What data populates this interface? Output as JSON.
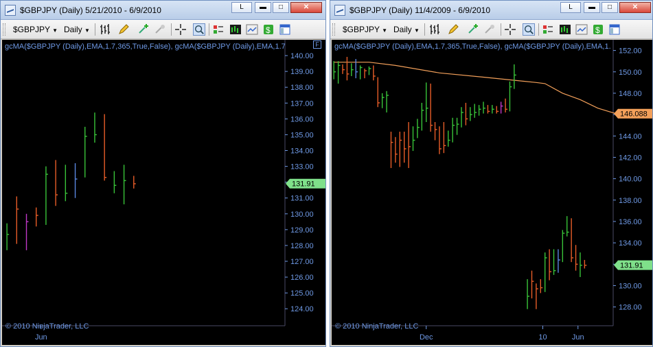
{
  "windows": [
    {
      "id": "left",
      "title": "$GBPJPY (Daily)  5/21/2010 - 6/9/2010",
      "title_buttons": [
        "L",
        "▬",
        "□",
        "✕"
      ],
      "toolbar": {
        "instrument": "$GBPJPY",
        "interval": "Daily"
      },
      "caption": "gcMA($GBPJPY (Daily),EMA,1.7,365,True,False), gcMA($GBPJPY (Daily),EMA,1.7",
      "corner_box": "F",
      "copyright": "© 2010 NinjaTrader, LLC",
      "price_badges": [
        {
          "text": "131.91",
          "value": 131.91,
          "color": "#7fe08a"
        }
      ]
    },
    {
      "id": "right",
      "title": "$GBPJPY (Daily)  11/4/2009 - 6/9/2010",
      "title_buttons": [
        "L",
        "▬",
        "□",
        "✕"
      ],
      "toolbar": {
        "instrument": "$GBPJPY",
        "interval": "Daily"
      },
      "caption": "gcMA($GBPJPY (Daily),EMA,1.7,365,True,False), gcMA($GBPJPY (Daily),EMA,1.",
      "corner_box": "",
      "copyright": "© 2010 NinjaTrader, LLC",
      "price_badges": [
        {
          "text": "146.088",
          "value": 146.088,
          "color": "#f3a05a"
        },
        {
          "text": "131.91",
          "value": 131.91,
          "color": "#7fe08a"
        }
      ]
    }
  ],
  "chart_data": [
    {
      "type": "ohlc",
      "instrument": "$GBPJPY (Daily)",
      "y_ticks": [
        140,
        139,
        138,
        137,
        136,
        135,
        134,
        133,
        132,
        131,
        130,
        129,
        128,
        127,
        126,
        125,
        124
      ],
      "y_tick_labels": [
        "140.00",
        "139.00",
        "138.00",
        "137.00",
        "136.00",
        "135.00",
        "134.00",
        "133.00",
        "132.00",
        "131.00",
        "130.00",
        "129.00",
        "128.00",
        "127.00",
        "126.00",
        "125.00",
        "124.00"
      ],
      "ylim": [
        123.1,
        141.0
      ],
      "x_labels": [
        {
          "label": "Jun",
          "bar": 3.5
        }
      ],
      "n_slots": 29,
      "bars": [
        {
          "h": 129.4,
          "l": 127.7,
          "c": 128.7,
          "color": "#39c439"
        },
        {
          "h": 131.1,
          "l": 128.1,
          "c": 130.3,
          "color": "#e85d28"
        },
        {
          "h": 130.0,
          "l": 127.7,
          "c": 129.5,
          "color": "#c038c8"
        },
        {
          "h": 130.4,
          "l": 129.2,
          "c": 129.9,
          "color": "#e85d28"
        },
        {
          "h": 133.0,
          "l": 129.3,
          "c": 132.5,
          "color": "#39c439"
        },
        {
          "h": 133.4,
          "l": 130.5,
          "c": 131.2,
          "color": "#e85d28"
        },
        {
          "h": 133.1,
          "l": 130.8,
          "c": 131.3,
          "color": "#39c439"
        },
        {
          "h": 133.2,
          "l": 131.0,
          "c": 132.2,
          "color": "#5a86e0"
        },
        {
          "h": 135.5,
          "l": 132.3,
          "c": 134.9,
          "color": "#39c439"
        },
        {
          "h": 136.4,
          "l": 134.5,
          "c": 135.0,
          "color": "#39c439"
        },
        {
          "h": 136.3,
          "l": 132.1,
          "c": 132.3,
          "color": "#e85d28"
        },
        {
          "h": 132.7,
          "l": 131.3,
          "c": 131.8,
          "color": "#39c439"
        },
        {
          "h": 133.1,
          "l": 130.6,
          "c": 132.1,
          "color": "#39c439"
        },
        {
          "h": 132.4,
          "l": 131.6,
          "c": 131.9,
          "color": "#e85d28"
        }
      ]
    },
    {
      "type": "ohlc",
      "instrument": "$GBPJPY (Daily)",
      "y_ticks": [
        152,
        150,
        148,
        146,
        144,
        142,
        140,
        138,
        136,
        134,
        132,
        130,
        128
      ],
      "y_tick_labels": [
        "152.00",
        "150.00",
        "148.00",
        "146.00",
        "144.00",
        "142.00",
        "140.00",
        "138.00",
        "136.00",
        "134.00",
        "132.00",
        "130.00",
        "128.00"
      ],
      "ylim": [
        126.5,
        153.0
      ],
      "x_labels": [
        {
          "label": "Dec",
          "bar": 21
        },
        {
          "label": "10",
          "bar": 47.5
        },
        {
          "label": "Jun",
          "bar": 55.5
        }
      ],
      "n_slots": 64,
      "ema": {
        "name": "gcMA EMA",
        "color": "#f3a05a",
        "points": [
          [
            0,
            150.9
          ],
          [
            8,
            150.9
          ],
          [
            14,
            150.6
          ],
          [
            24,
            149.9
          ],
          [
            34,
            149.5
          ],
          [
            46,
            149.0
          ],
          [
            48,
            148.9
          ],
          [
            52,
            148.0
          ],
          [
            56,
            147.4
          ],
          [
            60,
            146.6
          ],
          [
            64,
            146.1
          ]
        ]
      },
      "bars": [
        {
          "h": 151.0,
          "l": 149.3,
          "c": 150.0,
          "color": "#39c439"
        },
        {
          "h": 151.0,
          "l": 148.9,
          "c": 150.6,
          "color": "#39c439"
        },
        {
          "h": 150.7,
          "l": 149.8,
          "c": 150.2,
          "color": "#e85d28"
        },
        {
          "h": 151.4,
          "l": 149.2,
          "c": 149.8,
          "color": "#e85d28"
        },
        {
          "h": 150.8,
          "l": 149.6,
          "c": 150.2,
          "color": "#39c439"
        },
        {
          "h": 151.2,
          "l": 149.4,
          "c": 150.0,
          "color": "#5a86e0"
        },
        {
          "h": 150.6,
          "l": 149.3,
          "c": 150.4,
          "color": "#39c439"
        },
        {
          "h": 150.3,
          "l": 149.4,
          "c": 150.1,
          "color": "#e85d28"
        },
        {
          "h": 150.5,
          "l": 149.7,
          "c": 150.3,
          "color": "#39c439"
        },
        {
          "h": 150.6,
          "l": 149.2,
          "c": 149.6,
          "color": "#e85d28"
        },
        {
          "h": 149.5,
          "l": 146.7,
          "c": 147.1,
          "color": "#e85d28"
        },
        {
          "h": 148.0,
          "l": 146.6,
          "c": 147.6,
          "color": "#39c439"
        },
        {
          "h": 148.2,
          "l": 146.2,
          "c": 147.8,
          "color": "#39c439"
        },
        {
          "h": 144.4,
          "l": 141.0,
          "c": 143.4,
          "color": "#e85d28"
        },
        {
          "h": 143.9,
          "l": 141.5,
          "c": 142.3,
          "color": "#e85d28"
        },
        {
          "h": 144.4,
          "l": 141.1,
          "c": 143.6,
          "color": "#e85d28"
        },
        {
          "h": 144.4,
          "l": 141.5,
          "c": 142.8,
          "color": "#e85d28"
        },
        {
          "h": 145.3,
          "l": 141.0,
          "c": 143.0,
          "color": "#e85d28"
        },
        {
          "h": 144.9,
          "l": 142.6,
          "c": 143.6,
          "color": "#39c439"
        },
        {
          "h": 145.6,
          "l": 143.8,
          "c": 144.8,
          "color": "#39c439"
        },
        {
          "h": 147.1,
          "l": 144.5,
          "c": 146.4,
          "color": "#39c439"
        },
        {
          "h": 149.0,
          "l": 145.3,
          "c": 146.6,
          "color": "#39c439"
        },
        {
          "h": 148.9,
          "l": 144.4,
          "c": 145.0,
          "color": "#e85d28"
        },
        {
          "h": 145.3,
          "l": 143.6,
          "c": 144.6,
          "color": "#e85d28"
        },
        {
          "h": 144.9,
          "l": 142.3,
          "c": 142.8,
          "color": "#e85d28"
        },
        {
          "h": 145.3,
          "l": 142.4,
          "c": 143.1,
          "color": "#e85d28"
        },
        {
          "h": 144.5,
          "l": 143.0,
          "c": 143.6,
          "color": "#39c439"
        },
        {
          "h": 145.7,
          "l": 143.4,
          "c": 145.0,
          "color": "#39c439"
        },
        {
          "h": 145.7,
          "l": 144.1,
          "c": 145.1,
          "color": "#39c439"
        },
        {
          "h": 146.7,
          "l": 144.8,
          "c": 146.2,
          "color": "#39c439"
        },
        {
          "h": 147.1,
          "l": 145.0,
          "c": 145.6,
          "color": "#e85d28"
        },
        {
          "h": 146.7,
          "l": 145.4,
          "c": 146.0,
          "color": "#39c439"
        },
        {
          "h": 147.0,
          "l": 145.7,
          "c": 146.2,
          "color": "#39c439"
        },
        {
          "h": 146.9,
          "l": 145.9,
          "c": 146.5,
          "color": "#39c439"
        },
        {
          "h": 147.2,
          "l": 146.1,
          "c": 146.6,
          "color": "#39c439"
        },
        {
          "h": 146.9,
          "l": 146.1,
          "c": 146.3,
          "color": "#e85d28"
        },
        {
          "h": 146.9,
          "l": 146.1,
          "c": 146.5,
          "color": "#39c439"
        },
        {
          "h": 146.8,
          "l": 146.1,
          "c": 146.3,
          "color": "#e85d28"
        },
        {
          "h": 147.2,
          "l": 146.1,
          "c": 146.8,
          "color": "#c038c8"
        },
        {
          "h": 147.5,
          "l": 146.2,
          "c": 146.5,
          "color": "#e85d28"
        },
        {
          "h": 149.1,
          "l": 146.3,
          "c": 148.6,
          "color": "#39c439"
        },
        {
          "h": 150.7,
          "l": 148.4,
          "c": 149.7,
          "color": "#39c439"
        },
        {
          "h": null
        },
        {
          "h": null
        },
        {
          "h": 130.6,
          "l": 127.8,
          "c": 129.0,
          "color": "#39c439"
        },
        {
          "h": 131.4,
          "l": 128.8,
          "c": 130.4,
          "color": "#e85d28"
        },
        {
          "h": 130.2,
          "l": 127.8,
          "c": 129.7,
          "color": "#e85d28"
        },
        {
          "h": 130.6,
          "l": 129.3,
          "c": 129.8,
          "color": "#e85d28"
        },
        {
          "h": 133.1,
          "l": 129.4,
          "c": 132.6,
          "color": "#39c439"
        },
        {
          "h": 133.4,
          "l": 130.5,
          "c": 131.3,
          "color": "#e85d28"
        },
        {
          "h": 133.4,
          "l": 131.0,
          "c": 131.4,
          "color": "#39c439"
        },
        {
          "h": 133.4,
          "l": 131.2,
          "c": 132.4,
          "color": "#5a86e0"
        },
        {
          "h": 135.2,
          "l": 132.2,
          "c": 134.9,
          "color": "#39c439"
        },
        {
          "h": 136.5,
          "l": 134.6,
          "c": 135.0,
          "color": "#39c439"
        },
        {
          "h": 136.3,
          "l": 132.2,
          "c": 132.6,
          "color": "#e85d28"
        },
        {
          "h": 133.8,
          "l": 131.4,
          "c": 132.0,
          "color": "#e85d28"
        },
        {
          "h": 133.1,
          "l": 130.8,
          "c": 131.9,
          "color": "#39c439"
        },
        {
          "h": 132.4,
          "l": 131.6,
          "c": 131.9,
          "color": "#e85d28"
        }
      ]
    }
  ]
}
